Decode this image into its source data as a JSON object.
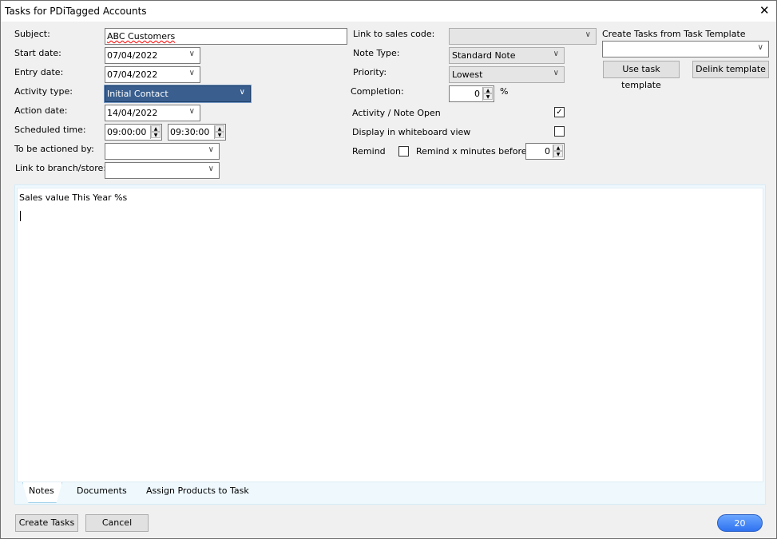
{
  "window": {
    "title": "Tasks for PDiTagged Accounts",
    "close_icon": "close-icon"
  },
  "left": {
    "subject_label": "Subject:",
    "subject_value": "ABC Customers",
    "start_label": "Start date:",
    "start_value": "07/04/2022",
    "entry_label": "Entry date:",
    "entry_value": "07/04/2022",
    "activity_label": "Activity type:",
    "activity_value": "Initial Contact",
    "action_label": "Action date:",
    "action_value": "14/04/2022",
    "sched_label": "Scheduled time:",
    "sched_start": "09:00:00",
    "sched_end": "09:30:00",
    "actioned_label": "To be actioned by:",
    "actioned_value": "",
    "branch_label": "Link to branch/store:",
    "branch_value": ""
  },
  "middle": {
    "sales_code_label": "Link to sales code:",
    "sales_code_value": "",
    "note_type_label": "Note Type:",
    "note_type_value": "Standard Note",
    "priority_label": "Priority:",
    "priority_value": "Lowest",
    "completion_label": "Completion:",
    "completion_value": "0",
    "completion_unit": "%",
    "open_label": "Activity / Note Open",
    "open_checked": true,
    "whiteboard_label": "Display in whiteboard view",
    "whiteboard_checked": false,
    "remind_label": "Remind",
    "remind_checked": false,
    "remind_minutes_label": "Remind x minutes before",
    "remind_minutes_value": "0"
  },
  "right": {
    "template_label": "Create Tasks from Task Template",
    "template_value": "",
    "use_button": "Use task template",
    "delink_button": "Delink template"
  },
  "notes": {
    "text": "Sales value This Year %s",
    "tabs": [
      {
        "label": "Notes",
        "active": true
      },
      {
        "label": "Documents"
      },
      {
        "label": "Assign Products to Task"
      }
    ]
  },
  "footer": {
    "create_button": "Create Tasks",
    "cancel_button": "Cancel",
    "badge": "20"
  },
  "colors": {
    "selected": "#3a5f8f",
    "badge": "#3f80f5"
  }
}
